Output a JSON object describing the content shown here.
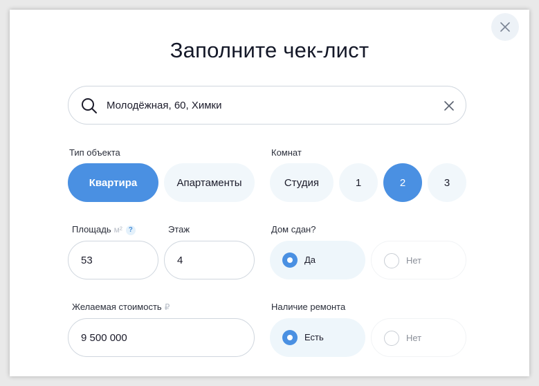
{
  "title": "Заполните чек-лист",
  "search": {
    "value": "Молодёжная, 60, Химки",
    "icon": "search-icon",
    "clear_icon": "close-icon"
  },
  "close_icon": "close-icon",
  "object_type": {
    "label": "Тип объекта",
    "options": [
      "Квартира",
      "Апартаменты"
    ],
    "selected": "Квартира"
  },
  "rooms": {
    "label": "Комнат",
    "options": [
      "Студия",
      "1",
      "2",
      "3"
    ],
    "selected": "2"
  },
  "area": {
    "label": "Площадь",
    "unit": "м²",
    "help": "?",
    "value": "53"
  },
  "floor": {
    "label": "Этаж",
    "value": "4"
  },
  "house_ready": {
    "label": "Дом сдан?",
    "options": [
      "Да",
      "Нет"
    ],
    "selected": "Да"
  },
  "price": {
    "label": "Желаемая стоимость",
    "unit": "₽",
    "value": "9 500 000"
  },
  "renovation": {
    "label": "Наличие ремонта",
    "options": [
      "Есть",
      "Нет"
    ],
    "selected": "Есть"
  },
  "colors": {
    "accent": "#4a90e2",
    "pill_bg": "#f1f7fb",
    "selected_radio_bg": "#eef6fb"
  }
}
